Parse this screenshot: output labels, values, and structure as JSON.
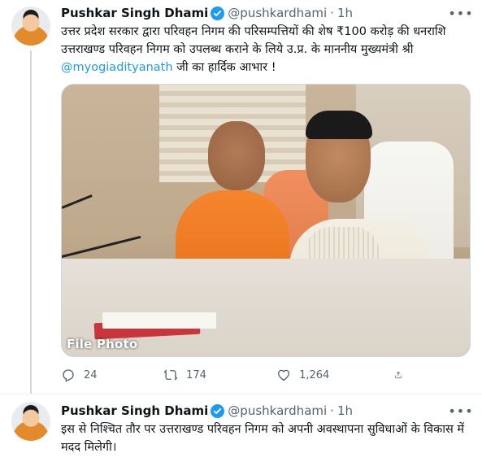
{
  "tweets": [
    {
      "author": {
        "name": "Pushkar Singh Dhami",
        "handle": "@pushkardhami",
        "verified": true,
        "avatar": "avatar"
      },
      "separator": "·",
      "time": "1h",
      "text_before": "उत्तर प्रदेश सरकार द्वारा परिवहन निगम की परिसम्पत्तियों की शेष ₹100 करोड़ की धनराशि उत्तराखण्ड परिवहन निगम को उपलब्ध कराने के लिये उ.प्र. के माननीय मुख्यमंत्री श्री ",
      "mention": "@myogiadityanath",
      "text_after": " जी का हार्दिक आभार !",
      "media": {
        "caption": "File Photo"
      },
      "actions": {
        "replies": "24",
        "retweets": "174",
        "likes": "1,264"
      }
    },
    {
      "author": {
        "name": "Pushkar Singh Dhami",
        "handle": "@pushkardhami",
        "verified": true,
        "avatar": "avatar"
      },
      "separator": "·",
      "time": "1h",
      "text": "इस से निश्चित तौर पर उत्तराखण्ड परिवहन निगम को अपनी अवस्थापना सुविधाओं के विकास में मदद मिलेगी।"
    }
  ],
  "colors": {
    "accent": "#1d9bf0",
    "secondary_text": "#536471",
    "divider": "#eff3f4"
  },
  "icons": [
    "verified-badge-icon",
    "more-icon",
    "reply-icon",
    "retweet-icon",
    "like-icon",
    "share-icon"
  ]
}
